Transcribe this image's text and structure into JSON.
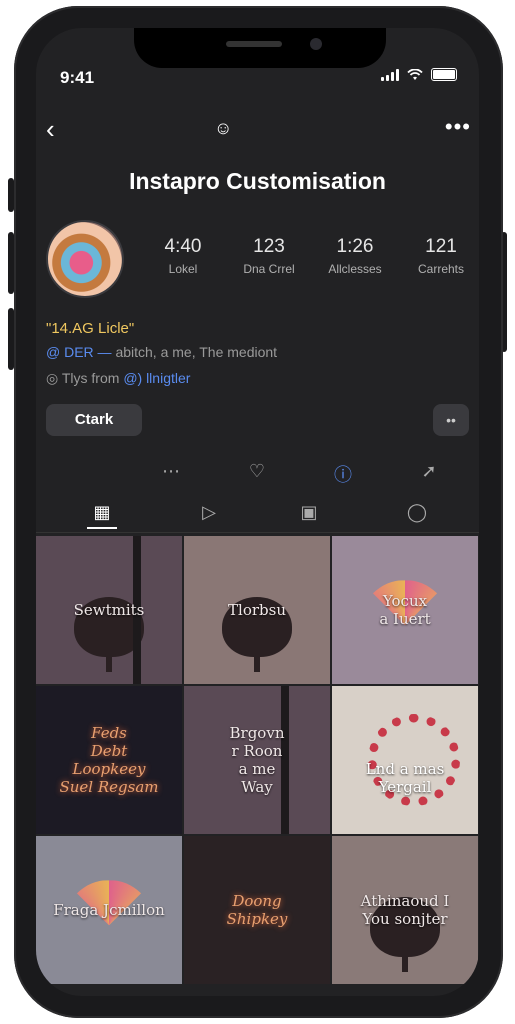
{
  "status": {
    "time": "9:41"
  },
  "nav": {
    "back": "‹",
    "center": "☺",
    "more": "•••"
  },
  "profile": {
    "title": "Instapro Customisation",
    "stats": [
      {
        "value": "4:40",
        "label": "Lokel"
      },
      {
        "value": "123",
        "label": "Dna Crrel"
      },
      {
        "value": "1:26",
        "label": "Allclesses"
      },
      {
        "value": "121",
        "label": "Carrehts"
      }
    ],
    "bio": {
      "line1": "\"14.AG Licle\"",
      "line2_link": "@ DER —",
      "line2_text": " abitch, a me, The mediont",
      "line3_text": "Tlys from ",
      "line3_link": "@) llnigtler"
    },
    "button_label": "Ctark",
    "more_label": "••"
  },
  "actions": [
    "⋯",
    "♡",
    "ⓘ",
    "➚"
  ],
  "tabs": [
    "▦",
    "▷",
    "▣",
    "◯"
  ],
  "grid": [
    {
      "caption": "Sewtmits",
      "kind": "tree-pole",
      "bg": "#5a4a55"
    },
    {
      "caption": "Tlorbsu",
      "kind": "tree",
      "bg": "#8a7775"
    },
    {
      "caption": "Yocux\na Iuert",
      "kind": "fan",
      "bg": "#9a8a9a"
    },
    {
      "caption": "Feds\nDebt\nLoopkeey\nSuel Regsam",
      "kind": "neon",
      "bg": "#1c1a24"
    },
    {
      "caption": "Brgovn\nr Roon\na me\nWay",
      "kind": "pole",
      "bg": "#5a4a55"
    },
    {
      "caption": "Lnd a mas\nYergail",
      "kind": "wreath",
      "bg": "#d8d0c8"
    },
    {
      "caption": "Fraga Jcmillon",
      "kind": "fan",
      "bg": "#8a8a96"
    },
    {
      "caption": "Doong\nShipkey",
      "kind": "neon",
      "bg": "#2a2224"
    },
    {
      "caption": "Athinaoud I\nYou sonjter",
      "kind": "tree",
      "bg": "#8a7a78"
    }
  ]
}
